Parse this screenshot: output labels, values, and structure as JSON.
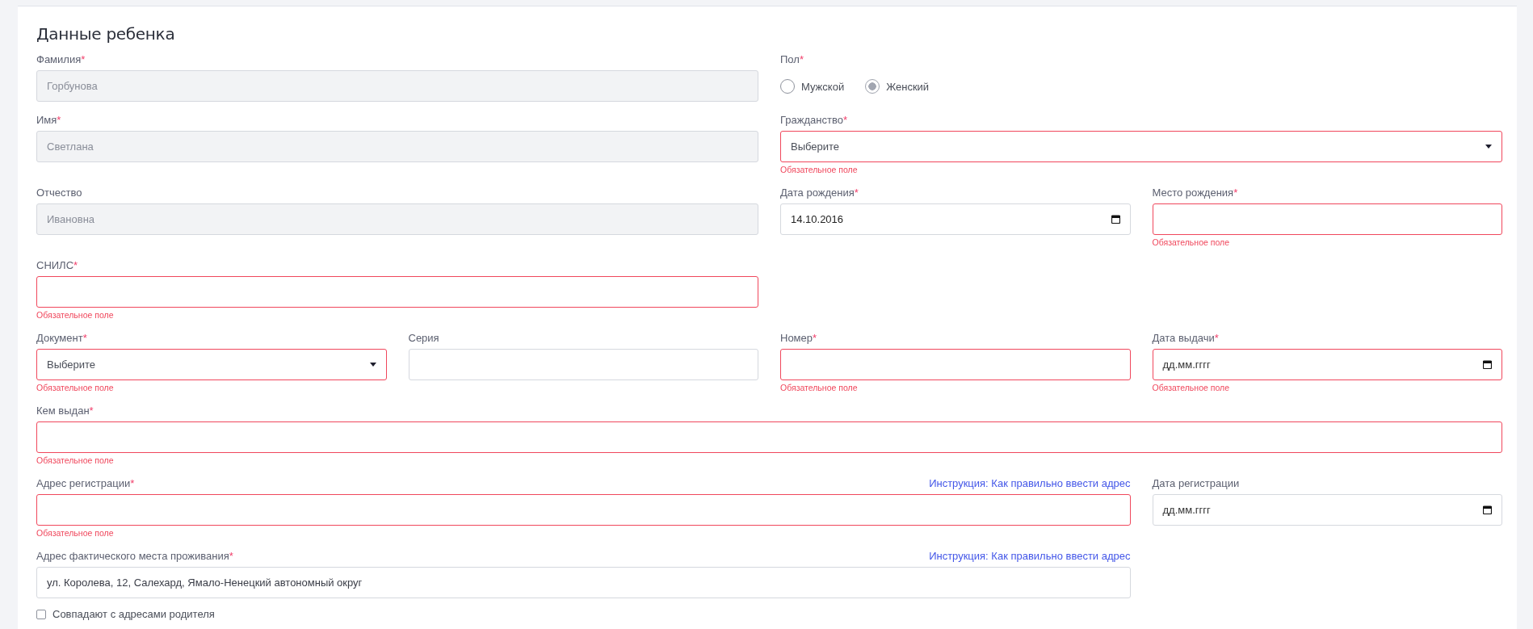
{
  "section_title": "Данные ребенка",
  "required_mark": "*",
  "fields": [
    {
      "kind": "text",
      "label": "Фамилия",
      "required": true,
      "value": "Горбунова",
      "disabled": true
    },
    {
      "kind": "radio",
      "label": "Пол",
      "required": true,
      "options": [
        {
          "label": "Мужской",
          "selected": false
        },
        {
          "label": "Женский",
          "selected": true
        }
      ]
    },
    {
      "kind": "text",
      "label": "Имя",
      "required": true,
      "value": "Светлана",
      "disabled": true
    },
    {
      "kind": "select",
      "label": "Гражданство",
      "required": true,
      "value": "Выберите",
      "error": "Обязательное поле"
    },
    {
      "kind": "text",
      "label": "Отчество",
      "required": false,
      "value": "Ивановна",
      "disabled": true
    },
    {
      "kind": "date",
      "label": "Дата рождения",
      "required": true,
      "value": "14.10.2016"
    },
    {
      "kind": "text",
      "label": "Место рождения",
      "required": true,
      "error": "Обязательное поле"
    },
    {
      "kind": "text",
      "label": "СНИЛС",
      "required": true,
      "error": "Обязательное поле"
    },
    {
      "kind": "select",
      "label": "Документ",
      "required": true,
      "value": "Выберите",
      "error": "Обязательное поле"
    },
    {
      "kind": "text",
      "label": "Серия",
      "required": false
    },
    {
      "kind": "text",
      "label": "Номер",
      "required": true,
      "error": "Обязательное поле"
    },
    {
      "kind": "date",
      "label": "Дата выдачи",
      "required": true,
      "placeholder": "дд.мм.гггг",
      "error": "Обязательное поле"
    },
    {
      "kind": "text",
      "label": "Кем выдан",
      "required": true,
      "error": "Обязательное поле"
    },
    {
      "kind": "text",
      "label": "Адрес регистрации",
      "required": true,
      "link": "Инструкция: Как правильно ввести адрес",
      "error": "Обязательное поле"
    },
    {
      "kind": "date",
      "label": "Дата регистрации",
      "required": false,
      "placeholder": "дд.мм.гггг"
    },
    {
      "kind": "text",
      "label": "Адрес фактического места проживания",
      "required": true,
      "link": "Инструкция: Как правильно ввести адрес",
      "value": "ул. Королева, 12, Салехард, Ямало-Ненецкий автономный округ"
    }
  ],
  "same_as_parent": {
    "label": "Совпадают с адресами родителя",
    "checked": false
  }
}
